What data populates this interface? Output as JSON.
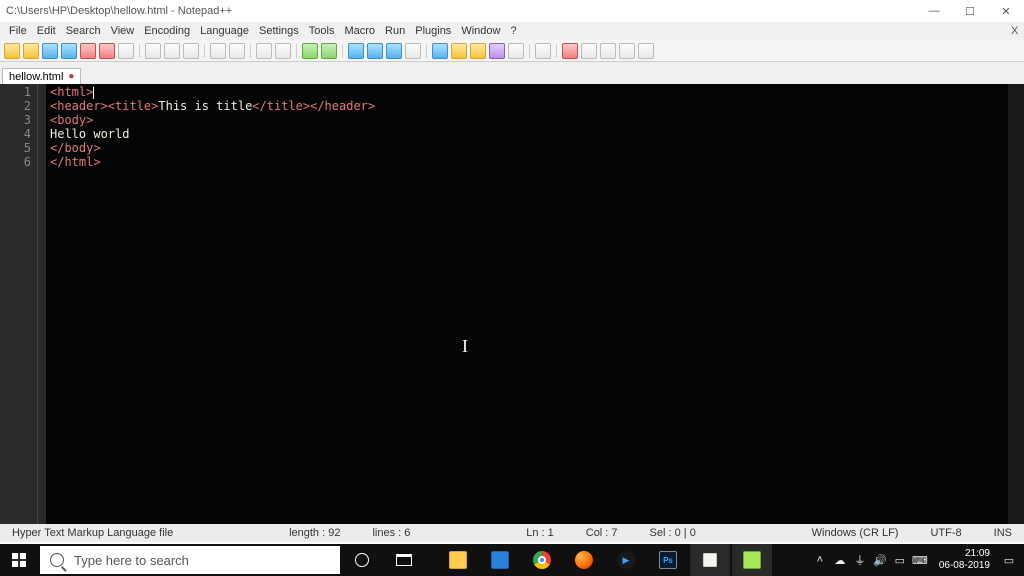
{
  "window": {
    "title": "C:\\Users\\HP\\Desktop\\hellow.html - Notepad++"
  },
  "menu": {
    "file": "File",
    "edit": "Edit",
    "search": "Search",
    "view": "View",
    "encoding": "Encoding",
    "language": "Language",
    "settings": "Settings",
    "tools": "Tools",
    "macro": "Macro",
    "run": "Run",
    "plugins": "Plugins",
    "window": "Window",
    "help": "?"
  },
  "tabs": {
    "items": [
      {
        "label": "hellow.html"
      }
    ]
  },
  "code": {
    "line1": {
      "open": "<html>"
    },
    "line2": {
      "open1": "<header>",
      "open2": "<title>",
      "text": "This is title",
      "close2": "</title>",
      "close1": "</header>"
    },
    "line3": {
      "open": "<body>"
    },
    "line4": {
      "text": "Hello world"
    },
    "line5": {
      "close": "</body>"
    },
    "line6": {
      "close": "</html>"
    }
  },
  "status": {
    "filetype": "Hyper Text Markup Language file",
    "length": "length : 92",
    "lines": "lines : 6",
    "ln": "Ln : 1",
    "col": "Col : 7",
    "sel": "Sel : 0 | 0",
    "eol": "Windows (CR LF)",
    "encoding": "UTF-8",
    "mode": "INS"
  },
  "taskbar": {
    "search_placeholder": "Type here to search",
    "time": "21:09",
    "date": "06-08-2019"
  }
}
